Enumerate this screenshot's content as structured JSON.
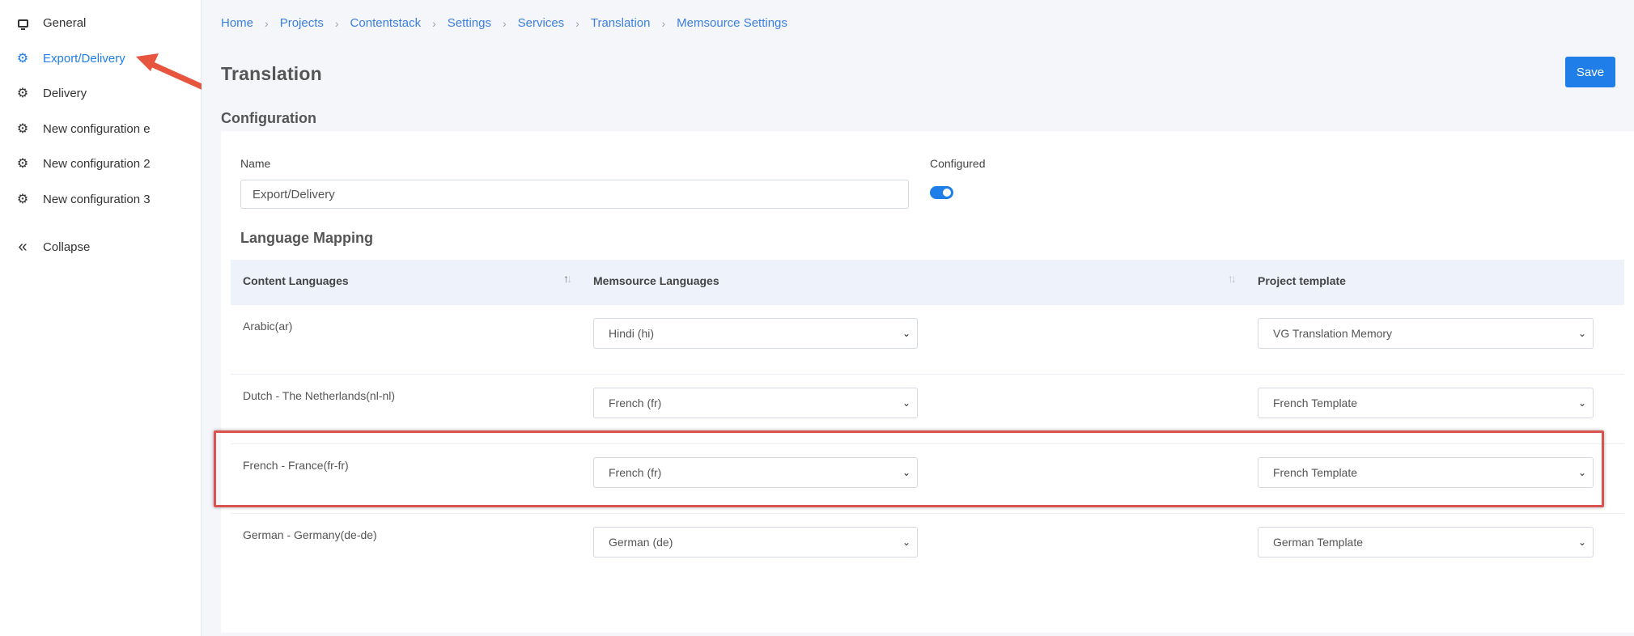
{
  "sidebar": {
    "items": [
      {
        "label": "General",
        "icon": "monitor-icon"
      },
      {
        "label": "Export/Delivery",
        "icon": "gear-icon",
        "active": true
      },
      {
        "label": "Delivery",
        "icon": "gear-icon"
      },
      {
        "label": "New configuration e",
        "icon": "gear-icon"
      },
      {
        "label": "New configuration 2",
        "icon": "gear-icon"
      },
      {
        "label": "New configuration 3",
        "icon": "gear-icon"
      }
    ],
    "collapse_label": "Collapse"
  },
  "breadcrumb": [
    "Home",
    "Projects",
    "Contentstack",
    "Settings",
    "Services",
    "Translation",
    "Memsource Settings"
  ],
  "page": {
    "title": "Translation",
    "save_label": "Save",
    "section_title": "Configuration"
  },
  "config": {
    "name_label": "Name",
    "name_value": "Export/Delivery",
    "configured_label": "Configured",
    "configured": true
  },
  "language_mapping": {
    "title": "Language Mapping",
    "columns": [
      "Content Languages",
      "Memsource Languages",
      "Project template"
    ],
    "rows": [
      {
        "content": "Arabic(ar)",
        "memsource": "Hindi (hi)",
        "template": "VG Translation Memory"
      },
      {
        "content": "Dutch - The Netherlands(nl-nl)",
        "memsource": "French (fr)",
        "template": "French Template"
      },
      {
        "content": "French - France(fr-fr)",
        "memsource": "French (fr)",
        "template": "French Template",
        "highlighted": true
      },
      {
        "content": "German - Germany(de-de)",
        "memsource": "German (de)",
        "template": "German Template"
      }
    ]
  },
  "colors": {
    "accent": "#1f7ee8",
    "highlight_border": "#d9534f",
    "arrow": "#e8553e",
    "table_header_bg": "#eef2fa"
  }
}
